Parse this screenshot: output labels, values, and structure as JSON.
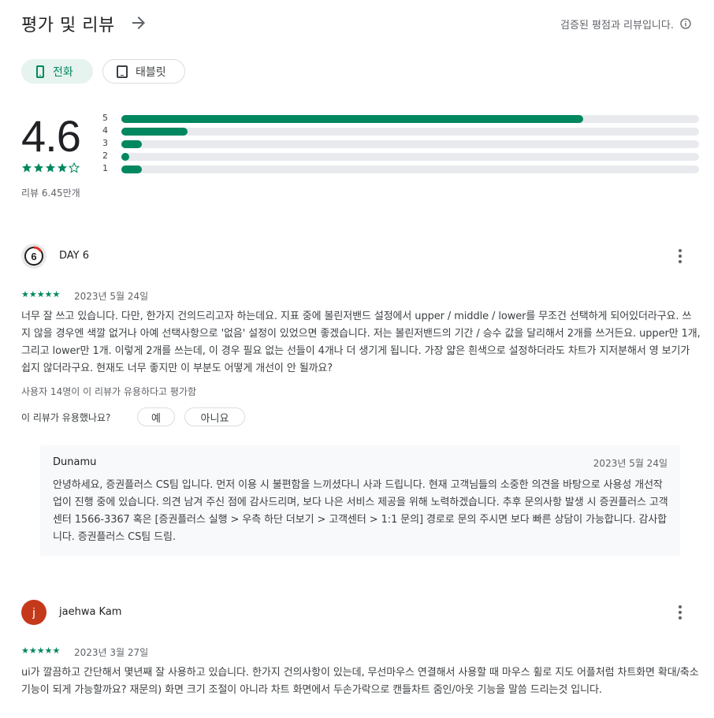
{
  "header": {
    "title": "평가 및 리뷰",
    "verified_text": "검증된 평점과 리뷰입니다."
  },
  "device_tabs": [
    {
      "label": "전화",
      "selected": true,
      "icon": "phone-icon"
    },
    {
      "label": "태블릿",
      "selected": false,
      "icon": "tablet-icon"
    }
  ],
  "summary": {
    "rating": "4.6",
    "stars": "★★★★★",
    "review_count": "리뷰 6.45만개",
    "distribution": [
      {
        "label": "5",
        "fraction": 0.8
      },
      {
        "label": "4",
        "fraction": 0.115
      },
      {
        "label": "3",
        "fraction": 0.035
      },
      {
        "label": "2",
        "fraction": 0.012
      },
      {
        "label": "1",
        "fraction": 0.035
      }
    ]
  },
  "colors": {
    "accent": "#01875f",
    "track": "#e8eaed",
    "reply_bg": "#f8f9fa"
  },
  "reviews": [
    {
      "name": "DAY 6",
      "stars": "★★★★★",
      "date": "2023년 5월 24일",
      "text": "너무 잘 쓰고 있습니다. 다만, 한가지 건의드리고자 하는데요. 지표 중에 볼린저밴드 설정에서 upper / middle / lower를 무조건 선택하게 되어있더라구요. 쓰지 않을 경우엔 색깔 없거나 아예 선택사항으로 '없음' 설정이 있었으면 좋겠습니다. 저는 볼린저밴드의 기간 / 승수 값을 달리해서 2개를 쓰거든요. upper만 1개, 그리고 lower만 1개. 이렇게 2개를 쓰는데, 이 경우 필요 없는 선들이 4개나 더 생기게 됩니다. 가장 얇은 흰색으로 설정하더라도 차트가 지저분해서 영 보기가 쉽지 않더라구요. 현재도 너무 좋지만 이 부분도 어떻게 개선이 안 될까요?",
      "helpful_count": "사용자 14명이 이 리뷰가 유용하다고 평가함",
      "helpful_question": "이 리뷰가 유용했나요?",
      "yes": "예",
      "no": "아니요",
      "reply": {
        "name": "Dunamu",
        "date": "2023년 5월 24일",
        "text": "안녕하세요, 증권플러스 CS팀 입니다. 먼저 이용 시 불편함을 느끼셨다니 사과 드립니다. 현재 고객님들의 소중한 의견을 바탕으로 사용성 개선작업이 진행 중에 있습니다. 의견 남겨 주신 점에 감사드리며, 보다 나은 서비스 제공을 위해 노력하겠습니다. 추후 문의사항 발생 시 증권플러스 고객센터 1566-3367 혹은 [증권플러스 실행 > 우측 하단 더보기 > 고객센터 > 1:1 문의] 경로로 문의 주시면 보다 빠른 상담이 가능합니다. 감사합니다. 증권플러스 CS팀 드림."
      }
    },
    {
      "name": "jaehwa Kam",
      "avatar_letter": "j",
      "stars": "★★★★★",
      "date": "2023년 3월 27일",
      "text": "ui가 깔끔하고 간단해서 몇년째 잘 사용하고 있습니다. 한가지 건의사항이 있는데, 무선마우스 연결해서 사용할 때 마우스 휠로 지도 어플처럼 차트화면 확대/축소 기능이 되게 가능할까요? 재문의) 화면 크기 조절이 아니라 차트 화면에서 두손가락으로 캔들차트 줌인/아웃 기능을 말씀 드리는것 입니다."
    }
  ]
}
